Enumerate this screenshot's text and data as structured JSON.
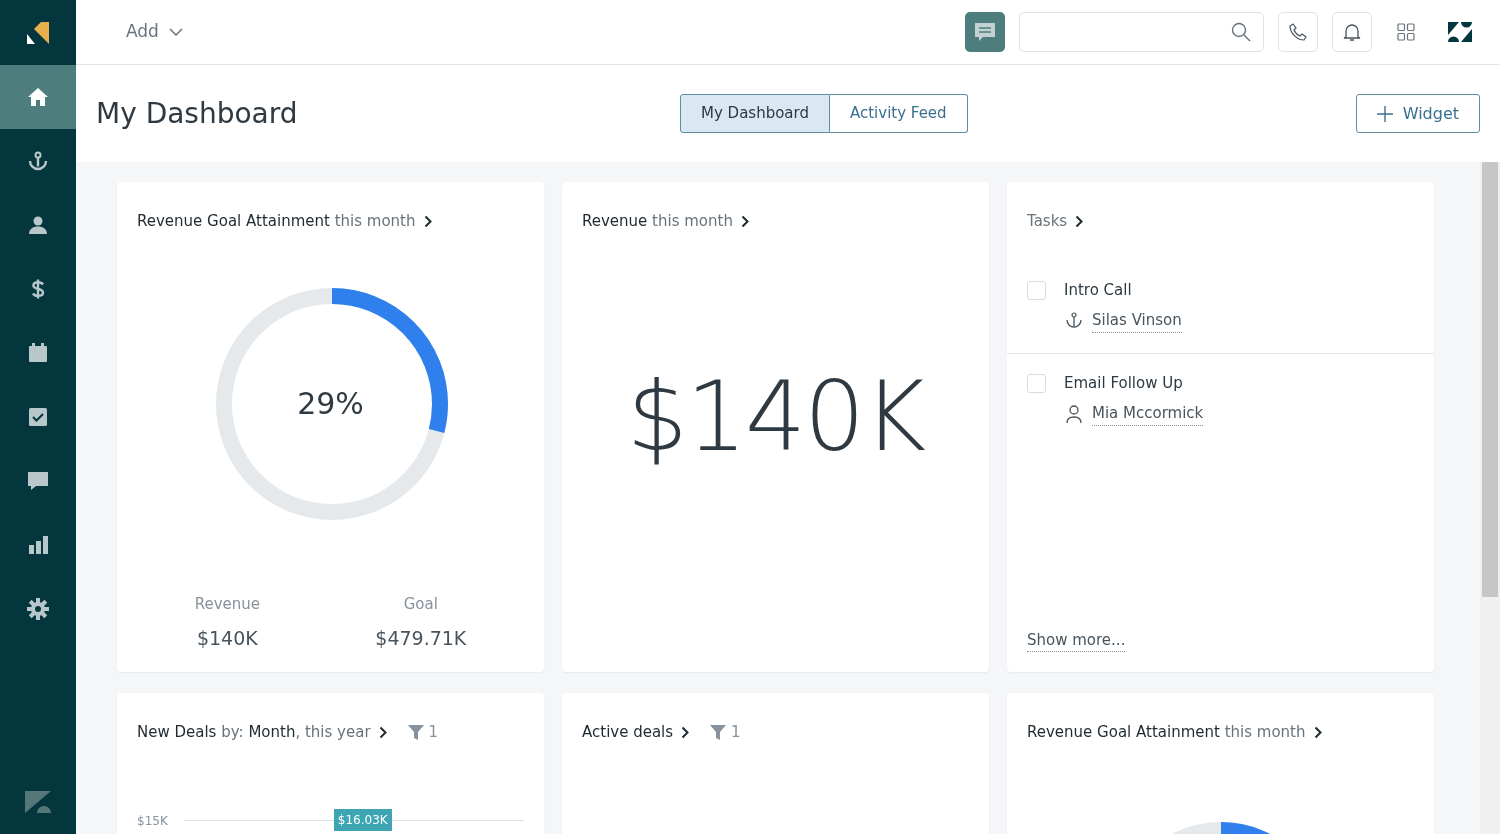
{
  "sidebar": {
    "items": [
      {
        "kind": "home",
        "selected": true
      },
      {
        "kind": "anchor",
        "selected": false
      },
      {
        "kind": "person",
        "selected": false
      },
      {
        "kind": "dollar",
        "selected": false
      },
      {
        "kind": "calendar",
        "selected": false
      },
      {
        "kind": "task",
        "selected": false
      },
      {
        "kind": "chat",
        "selected": false
      },
      {
        "kind": "chart",
        "selected": false
      },
      {
        "kind": "gear",
        "selected": false
      }
    ]
  },
  "topbar": {
    "add_menu": "Add"
  },
  "header": {
    "title": "My Dashboard",
    "tabs": [
      {
        "label": "My Dashboard",
        "selected": true
      },
      {
        "label": "Activity Feed",
        "selected": false
      }
    ],
    "widget_button": "Widget"
  },
  "widgets": [
    {
      "kind": "donut",
      "title": [
        {
          "text": "Revenue Goal Attainment",
          "muted": false
        },
        {
          "text": "this month",
          "muted": true
        }
      ],
      "level": 0.29,
      "percent": "29%",
      "stats": [
        {
          "label": "Revenue",
          "value": "$140K"
        },
        {
          "label": "Goal",
          "value": "$479.71K"
        }
      ]
    },
    {
      "kind": "number",
      "title": [
        {
          "text": "Revenue",
          "muted": false
        },
        {
          "text": "this month",
          "muted": true
        }
      ],
      "value": "$140K"
    },
    {
      "kind": "tasks",
      "title": [
        {
          "text": "Tasks",
          "muted": true
        }
      ],
      "tasks": [
        {
          "name": "Intro Call",
          "checked": false,
          "kind": "lead",
          "contact": "Silas Vinson"
        },
        {
          "name": "Email Follow Up",
          "checked": false,
          "kind": "person",
          "contact": "Mia Mccormick"
        }
      ],
      "more": "Show more..."
    },
    {
      "kind": "bars",
      "title": [
        {
          "text": "New Deals",
          "muted": false
        },
        {
          "text": "by:",
          "muted": true
        },
        {
          "text": "Month",
          "muted": false
        },
        {
          "text": ", this year",
          "muted": true
        }
      ],
      "filter_count": "1",
      "axis_label": "$15K",
      "bar_label": "$16.03K"
    },
    {
      "kind": "empty",
      "title": [
        {
          "text": "Active deals",
          "muted": false
        }
      ],
      "filter_count": "1"
    },
    {
      "kind": "donut_partial",
      "title": [
        {
          "text": "Revenue Goal Attainment",
          "muted": false
        },
        {
          "text": "this month",
          "muted": true
        }
      ]
    }
  ]
}
